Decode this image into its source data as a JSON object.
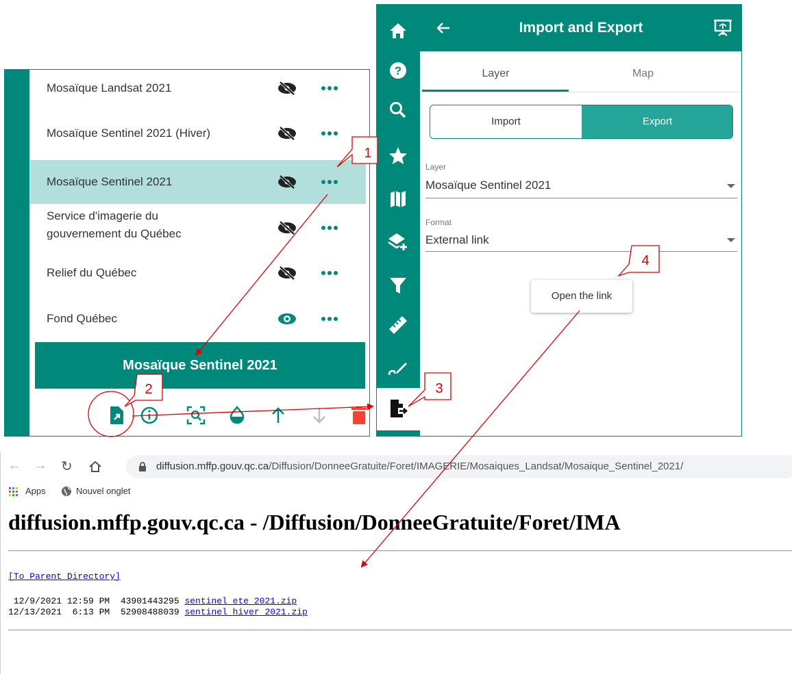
{
  "layers": [
    {
      "name": "Mosaïque Landsat 2021",
      "visible": false
    },
    {
      "name": "Mosaïque Sentinel 2021 (Hiver)",
      "visible": false
    },
    {
      "name": "Mosaïque Sentinel 2021",
      "visible": false,
      "selected": true
    },
    {
      "name_line1": "Service d'imagerie du",
      "name_line2": "gouvernement du Québec",
      "visible": false
    },
    {
      "name": "Relief du Québec",
      "visible": false
    },
    {
      "name": "Fond Québec",
      "visible": true
    }
  ],
  "selected_layer_title": "Mosaïque Sentinel 2021",
  "layer_tools": [
    "export-layer-icon",
    "info-icon",
    "zoom-to-layer-icon",
    "opacity-icon",
    "move-up-icon",
    "move-down-icon",
    "delete-icon"
  ],
  "side_nav": [
    "home-icon",
    "help-icon",
    "search-icon",
    "star-icon",
    "map-icon",
    "add-layer-icon",
    "filter-icon",
    "ruler-icon",
    "draw-icon",
    "import-export-icon"
  ],
  "panel": {
    "title": "Import and Export",
    "tabs": [
      "Layer",
      "Map"
    ],
    "toggle": {
      "import": "Import",
      "export": "Export"
    },
    "layer_label": "Layer",
    "layer_value": "Mosaïque Sentinel 2021",
    "format_label": "Format",
    "format_value": "External link",
    "open_link": "Open the link"
  },
  "browser": {
    "url_host": "diffusion.mffp.gouv.qc.ca",
    "url_path": "/Diffusion/DonneeGratuite/Foret/IMAGERIE/Mosaiques_Landsat/Mosaique_Sentinel_2021/",
    "bookmark_apps": "Apps",
    "bookmark_tab": "Nouvel onglet",
    "heading": "diffusion.mffp.gouv.qc.ca - /Diffusion/DonneeGratuite/Foret/IMA",
    "parent_link": "[To Parent Directory]",
    "files": [
      {
        "meta": " 12/9/2021 12:59 PM  43901443295 ",
        "name": "sentinel_ete_2021.zip"
      },
      {
        "meta": "12/13/2021  6:13 PM  52908488039 ",
        "name": "sentinel_hiver_2021.zip"
      }
    ]
  },
  "callouts": [
    "1",
    "2",
    "3",
    "4"
  ],
  "colors": {
    "primary": "#00897b",
    "selected_row": "#b2dfdb",
    "toggle_active": "#26a69a",
    "delete": "#f44336",
    "annotation": "#e00000"
  }
}
